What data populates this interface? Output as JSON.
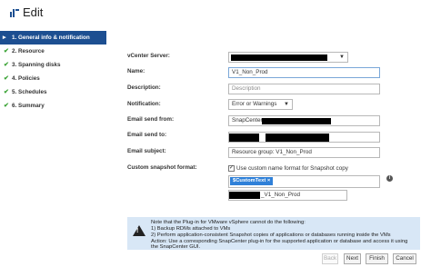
{
  "window": {
    "title": "Edit"
  },
  "sidebar": {
    "items": [
      {
        "label": "1. General info & notification",
        "state": "active"
      },
      {
        "label": "2. Resource",
        "state": "done"
      },
      {
        "label": "3. Spanning disks",
        "state": "done"
      },
      {
        "label": "4. Policies",
        "state": "done"
      },
      {
        "label": "5. Schedules",
        "state": "done"
      },
      {
        "label": "6. Summary",
        "state": "done"
      }
    ]
  },
  "form": {
    "vcenter_label": "vCenter Server:",
    "name_label": "Name:",
    "name_value": "V1_Non_Prod",
    "description_label": "Description:",
    "description_placeholder": "Description",
    "notification_label": "Notification:",
    "notification_value": "Error or Warnings",
    "email_from_label": "Email send from:",
    "email_from_prefix": "SnapCenter",
    "email_to_label": "Email send to:",
    "email_subject_label": "Email subject:",
    "email_subject_value": "Resource group: V1_Non_Prod",
    "snapshot_format_label": "Custom snapshot format:",
    "use_custom_checkbox_label": "Use custom name format for Snapshot copy",
    "custom_token": "$CustomText",
    "custom_token_remove": "×",
    "snapshot_suffix": "_V1_Non_Prod"
  },
  "note": {
    "lines": [
      "Note that the Plug-in for VMware vSphere cannot do the following:",
      "1) Backup RDMs attached to VMs",
      "2) Perform application-consistent Snapshot copies of applications or databases running inside the VMs",
      "Action: Use a corresponding SnapCenter plug-in for the supported application or database and access it using",
      "the SnapCenter GUI."
    ]
  },
  "buttons": {
    "back": "Back",
    "next": "Next",
    "finish": "Finish",
    "cancel": "Cancel"
  },
  "colors": {
    "accent": "#1d4f91",
    "done_check": "#3aa335",
    "note_background": "#d8e7f6",
    "token_background": "#2f80d8"
  },
  "icons": {
    "title": "edit-icon",
    "active_step": "triangle-right-icon",
    "done_step": "checkmark-icon",
    "warning": "warning-triangle-icon",
    "info": "info-icon"
  }
}
